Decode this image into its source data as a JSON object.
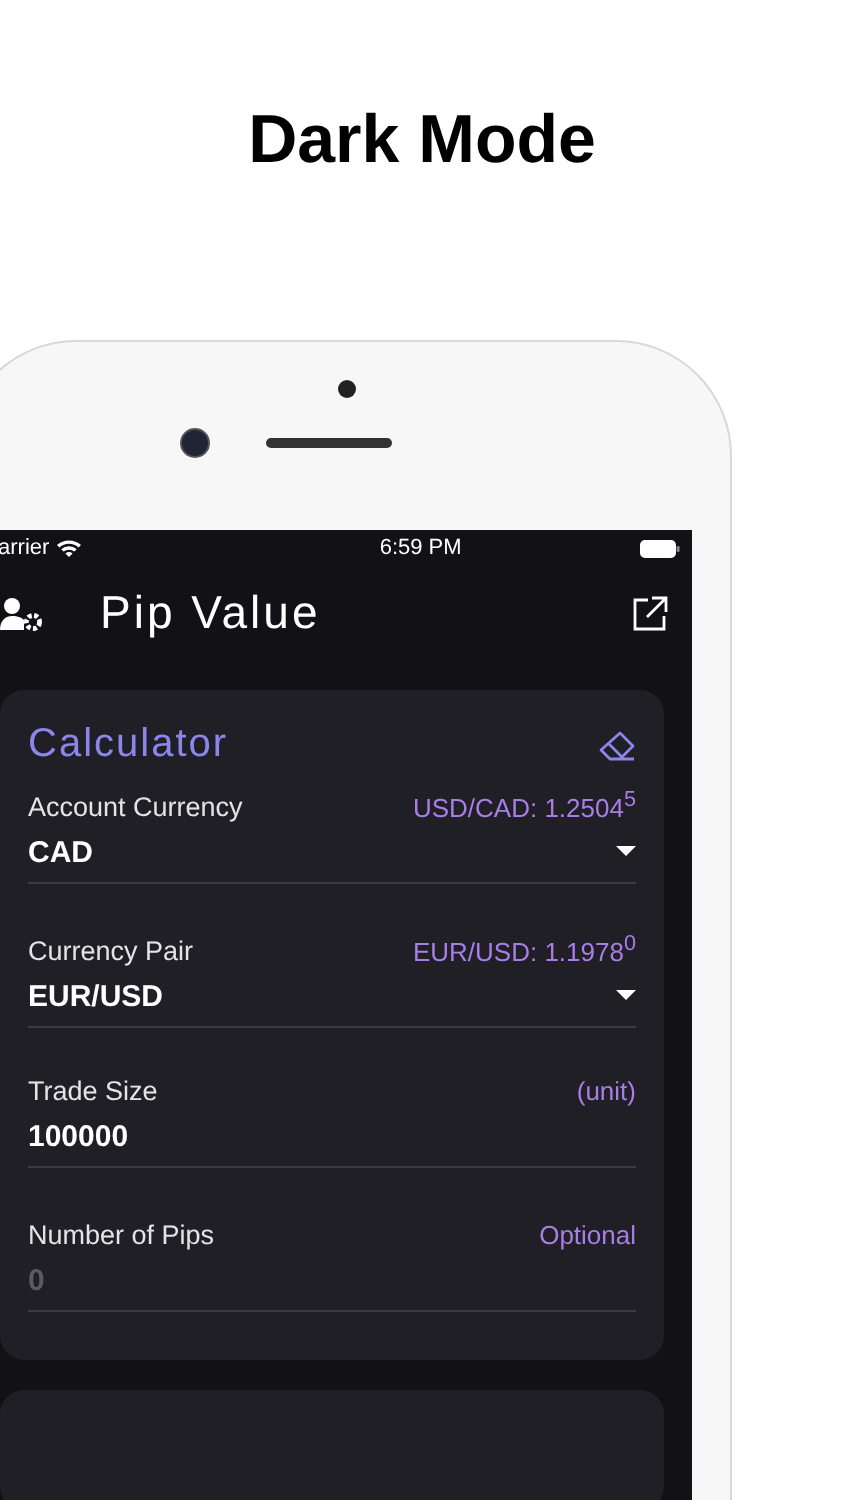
{
  "page_title": "Dark Mode",
  "status_bar": {
    "carrier": "arrier",
    "time": "6:59 PM"
  },
  "nav": {
    "title": "Pip Value"
  },
  "calculator": {
    "title": "Calculator",
    "fields": [
      {
        "kind": "dropdown",
        "label": "Account Currency",
        "note": "USD/CAD: 1.2504$^{5}$",
        "value": "CAD"
      },
      {
        "kind": "dropdown",
        "label": "Currency Pair",
        "note": "EUR/USD: 1.1978$^{0}$",
        "value": "EUR/USD"
      },
      {
        "kind": "input",
        "label": "Trade Size",
        "note": "(unit)",
        "value": "100000"
      },
      {
        "kind": "input",
        "label": "Number of Pips",
        "note": "Optional",
        "placeholder": "0"
      }
    ]
  }
}
